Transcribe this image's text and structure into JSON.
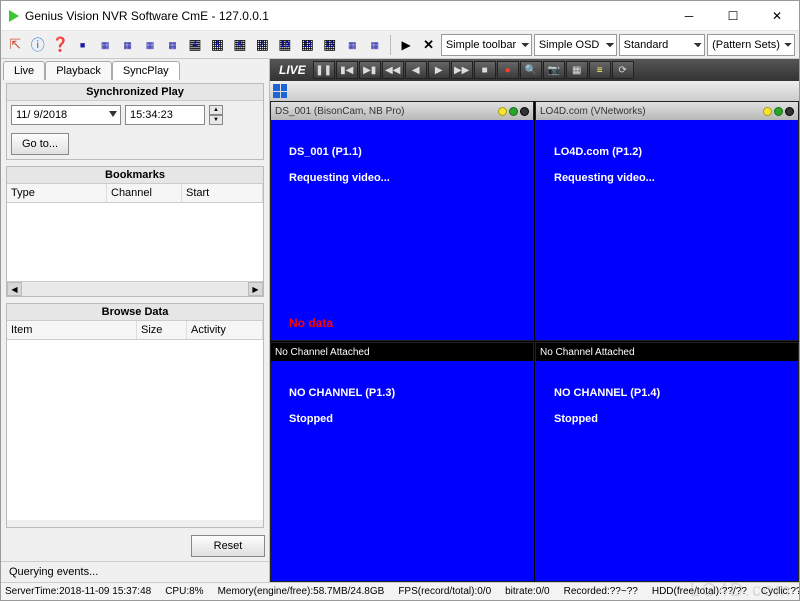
{
  "window": {
    "title": "Genius Vision NVR Software CmE - 127.0.0.1"
  },
  "toolbar": {
    "play_label": "▶",
    "stop_label": "✕",
    "selects": {
      "toolbar_mode": "Simple toolbar",
      "osd_mode": "Simple OSD",
      "layout_mode": "Standard",
      "pattern_sets": "(Pattern Sets)"
    }
  },
  "tabs": {
    "live": "Live",
    "playback": "Playback",
    "syncplay": "SyncPlay"
  },
  "sync": {
    "title": "Synchronized Play",
    "date": "11/ 9/2018",
    "time": "15:34:23",
    "goto": "Go to..."
  },
  "bookmarks": {
    "title": "Bookmarks",
    "cols": {
      "type": "Type",
      "channel": "Channel",
      "start": "Start"
    }
  },
  "browse": {
    "title": "Browse Data",
    "cols": {
      "item": "Item",
      "size": "Size",
      "activity": "Activity"
    }
  },
  "reset": "Reset",
  "querying": "Querying events...",
  "player": {
    "live": "LIVE"
  },
  "panes": [
    {
      "head": "DS_001 (BisonCam, NB Pro)",
      "head_dark": false,
      "line1": "DS_001 (P1.1)",
      "line2": "Requesting video...",
      "nodata": "No data"
    },
    {
      "head": "LO4D.com (VNetworks)",
      "head_dark": false,
      "line1": "LO4D.com (P1.2)",
      "line2": "Requesting video...",
      "nodata": ""
    },
    {
      "head": "No Channel Attached",
      "head_dark": true,
      "line1": "NO CHANNEL (P1.3)",
      "line2": "Stopped",
      "nodata": ""
    },
    {
      "head": "No Channel Attached",
      "head_dark": true,
      "line1": "NO CHANNEL (P1.4)",
      "line2": "Stopped",
      "nodata": ""
    }
  ],
  "status": {
    "servertime": "ServerTime:2018-11-09 15:37:48",
    "cpu": "CPU:8%",
    "memory": "Memory(engine/free):58.7MB/24.8GB",
    "fps": "FPS(record/total):0/0",
    "bitrate": "bitrate:0/0",
    "recorded": "Recorded:??~??",
    "hdd": "HDD(free/total):??/??",
    "cyclic": "Cyclic:??"
  },
  "watermark": "LO4D.com"
}
